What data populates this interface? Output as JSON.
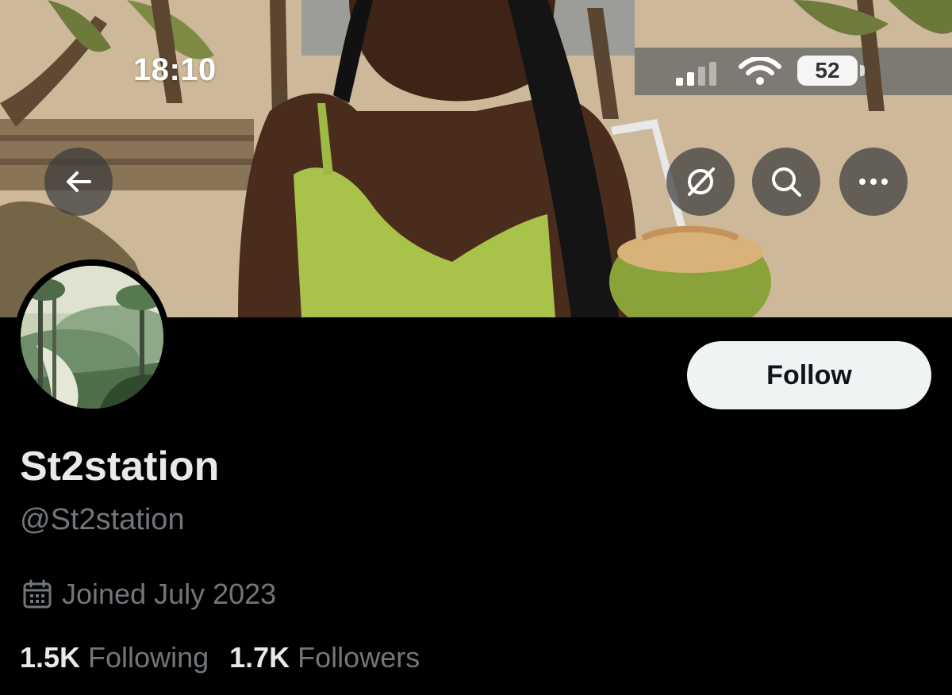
{
  "status_bar": {
    "time": "18:10",
    "battery_level": "52",
    "signal": "cellular-signal-icon",
    "wifi": "wifi-icon"
  },
  "header": {
    "back_icon": "arrow-left-icon",
    "grok_icon": "grok-icon",
    "search_icon": "search-icon",
    "more_icon": "more-horizontal-icon"
  },
  "profile": {
    "display_name": "St2station",
    "handle": "@St2station",
    "joined": "Joined July 2023",
    "follow_label": "Follow",
    "following_count": "1.5K",
    "following_label": "Following",
    "followers_count": "1.7K",
    "followers_label": "Followers"
  },
  "colors": {
    "background": "#000000",
    "text_primary": "#e7e9ea",
    "text_secondary": "#71767b",
    "follow_button_bg": "#eff3f4"
  }
}
